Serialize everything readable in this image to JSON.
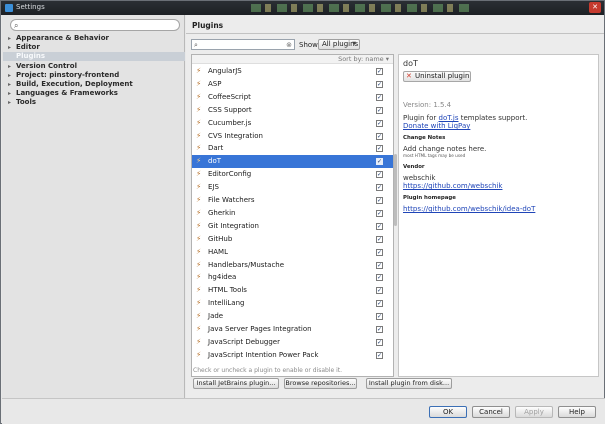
{
  "window": {
    "title": "Settings",
    "close_glyph": "✕"
  },
  "sidebar": {
    "search_placeholder": "",
    "items": [
      {
        "label": "Appearance & Behavior",
        "expander": "▸"
      },
      {
        "label": "Editor",
        "expander": "▸"
      },
      {
        "label": "Plugins",
        "expander": ""
      },
      {
        "label": "Version Control",
        "expander": "▸"
      },
      {
        "label": "Project: pinstory-frontend",
        "expander": "▸"
      },
      {
        "label": "Build, Execution, Deployment",
        "expander": "▸"
      },
      {
        "label": "Languages & Frameworks",
        "expander": "▸"
      },
      {
        "label": "Tools",
        "expander": "▸"
      }
    ],
    "selected_index": 2
  },
  "plugins": {
    "header": "Plugins",
    "filter_value": "",
    "show_label": "Show:",
    "show_value": "All plugins",
    "sort_label": "Sort by: name ▾",
    "list": [
      {
        "name": "AngularJS",
        "checked": "✓"
      },
      {
        "name": "ASP",
        "checked": "✓"
      },
      {
        "name": "CoffeeScript",
        "checked": "✓"
      },
      {
        "name": "CSS Support",
        "checked": "✓"
      },
      {
        "name": "Cucumber.js",
        "checked": "✓"
      },
      {
        "name": "CVS Integration",
        "checked": "✓"
      },
      {
        "name": "Dart",
        "checked": "✓"
      },
      {
        "name": "doT",
        "checked": "✓",
        "selected": true
      },
      {
        "name": "EditorConfig",
        "checked": "✓"
      },
      {
        "name": "EJS",
        "checked": "✓"
      },
      {
        "name": "File Watchers",
        "checked": "✓"
      },
      {
        "name": "Gherkin",
        "checked": "✓"
      },
      {
        "name": "Git Integration",
        "checked": "✓"
      },
      {
        "name": "GitHub",
        "checked": "✓"
      },
      {
        "name": "HAML",
        "checked": "✓"
      },
      {
        "name": "Handlebars/Mustache",
        "checked": "✓"
      },
      {
        "name": "hg4idea",
        "checked": "✓"
      },
      {
        "name": "HTML Tools",
        "checked": "✓"
      },
      {
        "name": "IntelliLang",
        "checked": "✓"
      },
      {
        "name": "Jade",
        "checked": "✓"
      },
      {
        "name": "Java Server Pages Integration",
        "checked": "✓"
      },
      {
        "name": "JavaScript Debugger",
        "checked": "✓"
      },
      {
        "name": "JavaScript Intention Power Pack",
        "checked": "✓"
      }
    ],
    "hint": "Check or uncheck a plugin to enable or disable it.",
    "buttons": {
      "install_jetbrains": "Install JetBrains plugin...",
      "browse_repos": "Browse repositories...",
      "install_disk": "Install plugin from disk..."
    }
  },
  "details": {
    "title": "doT",
    "uninstall": "Uninstall plugin",
    "version": "Version: 1.5.4",
    "desc_prefix": "Plugin for",
    "desc_link": "doT.js",
    "desc_suffix": "templates support.",
    "donate": "Donate with LiqPay",
    "change_notes_head": "Change Notes",
    "change_notes_1": "Add change notes here.",
    "change_notes_2": "most HTML tags may be used",
    "vendor_head": "Vendor",
    "vendor_name": "webschik",
    "vendor_url": "https://github.com/webschik",
    "homepage_head": "Plugin homepage",
    "homepage_url": "https://github.com/webschik/idea-doT"
  },
  "footer": {
    "ok": "OK",
    "cancel": "Cancel",
    "apply": "Apply",
    "help": "Help"
  },
  "icons": {
    "search": "search-icon",
    "plugin": "plug-icon",
    "clear": "clear-icon"
  }
}
